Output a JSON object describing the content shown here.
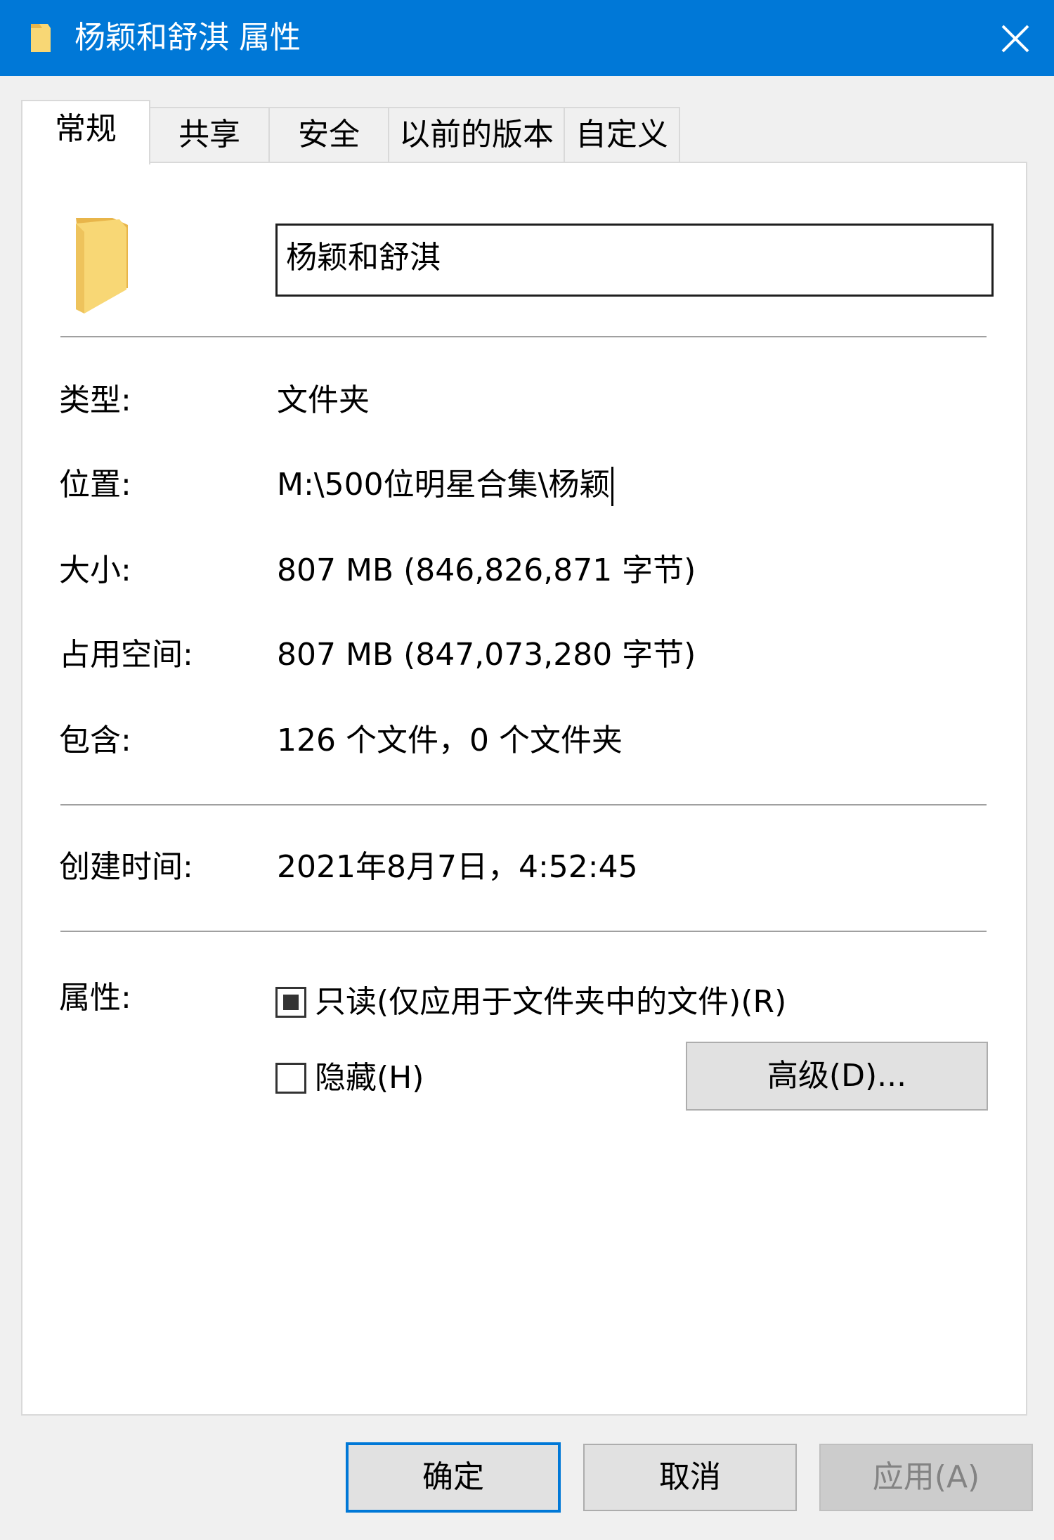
{
  "window": {
    "title": "杨颖和舒淇 属性"
  },
  "tabs": [
    {
      "label": "常规",
      "active": true
    },
    {
      "label": "共享"
    },
    {
      "label": "安全"
    },
    {
      "label": "以前的版本"
    },
    {
      "label": "自定义"
    }
  ],
  "general": {
    "folder_name": "杨颖和舒淇",
    "type": {
      "label": "类型:",
      "value": "文件夹"
    },
    "location": {
      "label": "位置:",
      "value": "M:\\500位明星合集\\杨颖"
    },
    "size": {
      "label": "大小:",
      "value": "807 MB (846,826,871 字节)"
    },
    "size_on_disk": {
      "label": "占用空间:",
      "value": "807 MB (847,073,280 字节)"
    },
    "contains": {
      "label": "包含:",
      "value": "126 个文件，0 个文件夹"
    },
    "created": {
      "label": "创建时间:",
      "value": "2021年8月7日，4:52:45"
    },
    "attributes": {
      "label": "属性:",
      "readonly_label": "只读(仅应用于文件夹中的文件)(R)",
      "readonly_state": "indeterminate",
      "hidden_label": "隐藏(H)",
      "hidden_checked": false,
      "advanced_label": "高级(D)..."
    }
  },
  "buttons": {
    "ok": "确定",
    "cancel": "取消",
    "apply": "应用(A)"
  },
  "colors": {
    "titlebar": "#0078d7",
    "folder": "#f8d775",
    "accent": "#0078d7"
  },
  "icons": {
    "folder": "folder-icon",
    "close": "close-icon"
  }
}
